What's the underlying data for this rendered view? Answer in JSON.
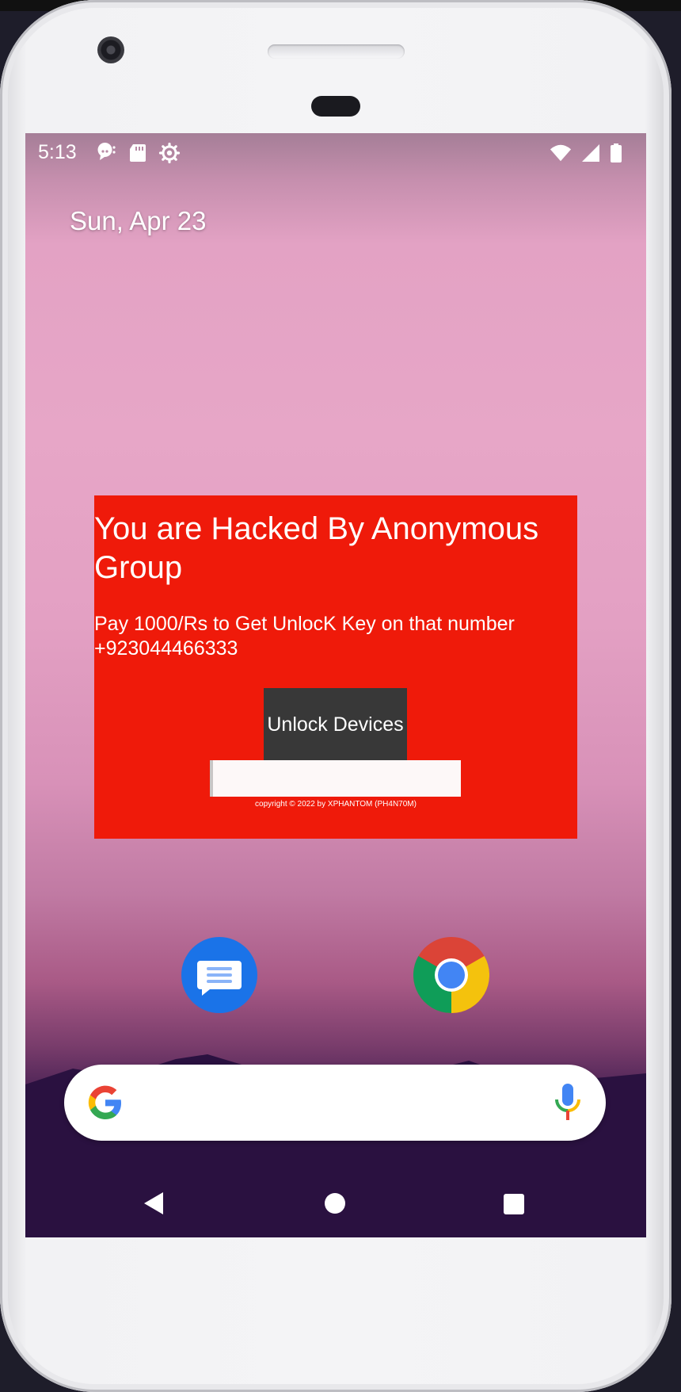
{
  "status_bar": {
    "time": "5:13",
    "left_icons": [
      "assistant-icon",
      "sd-card-icon",
      "settings-icon"
    ],
    "right_icons": [
      "wifi-icon",
      "cell-signal-icon",
      "battery-icon"
    ]
  },
  "home_screen": {
    "date": "Sun, Apr 23"
  },
  "ransom_overlay": {
    "background_color": "#ef1a0a",
    "title": "You are Hacked By Anonymous Group",
    "message_line1": "Pay 1000/Rs to Get UnlocK Key on that number",
    "message_line2": "+923044466333",
    "unlock_button_label": "Unlock Devices",
    "key_input_value": "",
    "copyright": "copyright © 2022 by XPHANTOM (PH4N70M)"
  },
  "dock": {
    "apps": [
      "messages-icon",
      "chrome-icon"
    ]
  },
  "search_widget": {
    "icons": [
      "google-logo-icon",
      "microphone-icon"
    ]
  },
  "navigation": {
    "buttons": [
      "back-icon",
      "home-icon",
      "recents-icon"
    ]
  },
  "colors": {
    "overlay_red": "#ef1a0a",
    "button_gray": "#383838",
    "messages_blue": "#1a73e8"
  }
}
